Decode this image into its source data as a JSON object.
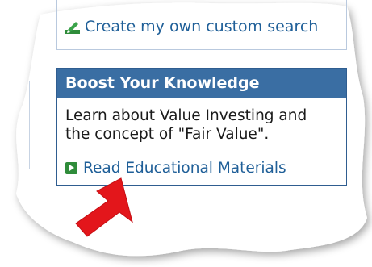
{
  "custom_search": {
    "label": "Create my own custom search",
    "icon": "pencil-icon"
  },
  "knowledge_box": {
    "title": "Boost Your Knowledge",
    "description": "Learn about Value Investing and the concept of \"Fair Value\".",
    "link_label": "Read Educational Materials",
    "link_icon": "green-arrow-icon"
  },
  "colors": {
    "header_bg": "#3a6ea3",
    "link": "#1f5f98",
    "pointer": "#e3161b",
    "link_icon_bg": "#2f8c3a"
  }
}
